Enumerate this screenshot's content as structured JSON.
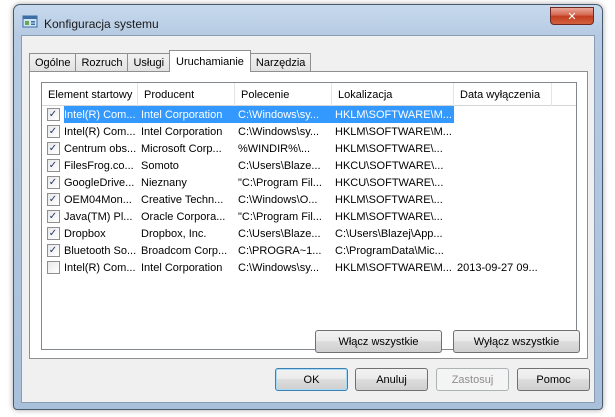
{
  "window": {
    "title": "Konfiguracja systemu",
    "close_glyph": "✕"
  },
  "tabs": [
    {
      "label": "Ogólne",
      "active": false
    },
    {
      "label": "Rozruch",
      "active": false
    },
    {
      "label": "Usługi",
      "active": false
    },
    {
      "label": "Uruchamianie",
      "active": true
    },
    {
      "label": "Narzędzia",
      "active": false
    }
  ],
  "listview": {
    "columns": [
      "Element startowy",
      "Producent",
      "Polecenie",
      "Lokalizacja",
      "Data wyłączenia"
    ],
    "rows": [
      {
        "checked": true,
        "selected": true,
        "cells": [
          "Intel(R) Com...",
          "Intel Corporation",
          "C:\\Windows\\sy...",
          "HKLM\\SOFTWARE\\M...",
          ""
        ]
      },
      {
        "checked": true,
        "selected": false,
        "cells": [
          "Intel(R) Com...",
          "Intel Corporation",
          "C:\\Windows\\sy...",
          "HKLM\\SOFTWARE\\M...",
          ""
        ]
      },
      {
        "checked": true,
        "selected": false,
        "cells": [
          "Centrum obs...",
          "Microsoft Corp...",
          "%WINDIR%\\...",
          "HKLM\\SOFTWARE\\...",
          ""
        ]
      },
      {
        "checked": true,
        "selected": false,
        "cells": [
          "FilesFrog.co...",
          "Somoto",
          "C:\\Users\\Blaze...",
          "HKCU\\SOFTWARE\\...",
          ""
        ]
      },
      {
        "checked": true,
        "selected": false,
        "cells": [
          "GoogleDrive...",
          "Nieznany",
          "\"C:\\Program Fil...",
          "HKCU\\SOFTWARE\\...",
          ""
        ]
      },
      {
        "checked": true,
        "selected": false,
        "cells": [
          "OEM04Mon...",
          "Creative Techn...",
          "C:\\Windows\\O...",
          "HKLM\\SOFTWARE\\...",
          ""
        ]
      },
      {
        "checked": true,
        "selected": false,
        "cells": [
          "Java(TM) Pl...",
          "Oracle Corpora...",
          "\"C:\\Program Fil...",
          "HKLM\\SOFTWARE\\...",
          ""
        ]
      },
      {
        "checked": true,
        "selected": false,
        "cells": [
          "Dropbox",
          "Dropbox, Inc.",
          "C:\\Users\\Blaze...",
          "C:\\Users\\Blazej\\App...",
          ""
        ]
      },
      {
        "checked": true,
        "selected": false,
        "cells": [
          "Bluetooth So...",
          "Broadcom Corp...",
          "C:\\PROGRA~1...",
          "C:\\ProgramData\\Mic...",
          ""
        ]
      },
      {
        "checked": false,
        "selected": false,
        "cells": [
          "Intel(R) Com...",
          "Intel Corporation",
          "C:\\Windows\\sy...",
          "HKLM\\SOFTWARE\\M...",
          "2013-09-27 09..."
        ]
      }
    ]
  },
  "buttons": {
    "enable_all": "Włącz wszystkie",
    "disable_all": "Wyłącz wszystkie",
    "ok": "OK",
    "cancel": "Anuluj",
    "apply": "Zastosuj",
    "help": "Pomoc"
  },
  "checkmark_glyph": "✓",
  "colors": {
    "selection": "#3399ff",
    "title_gradient_top": "#c7d9ed",
    "close_button": "#c23d1f"
  }
}
